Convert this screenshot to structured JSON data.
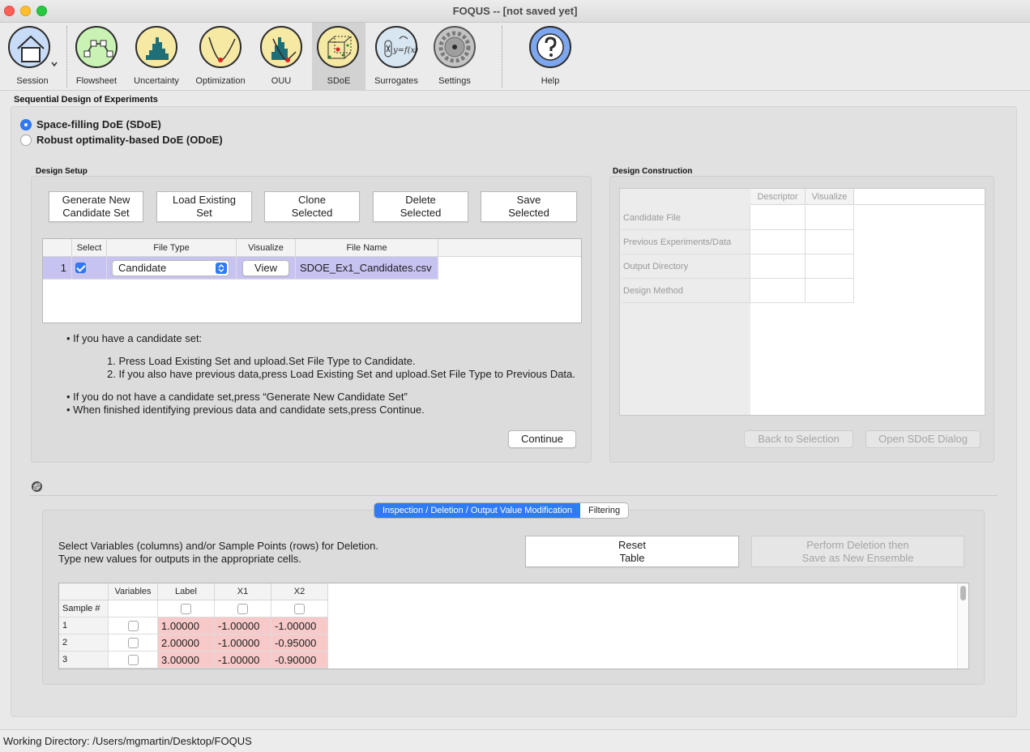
{
  "window": {
    "title": "FOQUS -- [not saved yet]"
  },
  "toolbar": {
    "items": [
      {
        "label": "Session",
        "icon": "house-icon"
      },
      {
        "label": "Flowsheet",
        "icon": "flowsheet-icon"
      },
      {
        "label": "Uncertainty",
        "icon": "histogram-icon"
      },
      {
        "label": "Optimization",
        "icon": "optimization-curve-icon"
      },
      {
        "label": "OUU",
        "icon": "ouu-icon"
      },
      {
        "label": "SDoE",
        "icon": "cube-icon"
      },
      {
        "label": "Surrogates",
        "icon": "function-icon"
      },
      {
        "label": "Settings",
        "icon": "gear-icon"
      },
      {
        "label": "Help",
        "icon": "help-icon"
      }
    ],
    "active": "SDoE",
    "surrogate_formula": "y=f(x)"
  },
  "page": {
    "title": "Sequential Design of Experiments",
    "radio_sdoe": "Space-filling DoE (SDoE)",
    "radio_odoe": "Robust optimality-based DoE (ODoE)"
  },
  "design_setup": {
    "title": "Design Setup",
    "buttons": {
      "generate": "Generate New\nCandidate Set",
      "load": "Load Existing\nSet",
      "clone": "Clone\nSelected",
      "delete": "Delete\nSelected",
      "save": "Save\nSelected"
    },
    "table": {
      "headers": [
        "",
        "Select",
        "File Type",
        "Visualize",
        "File Name"
      ],
      "rows": [
        {
          "index": "1",
          "selected": true,
          "file_type": "Candidate",
          "visualize": "View",
          "file_name": "SDOE_Ex1_Candidates.csv"
        }
      ]
    },
    "instructions": {
      "b1": "If you have a candidate set:",
      "s1": "1. Press Load Existing Set and upload.Set File Type to Candidate.",
      "s2": "2. If you also have previous data,press Load Existing Set and upload.Set File Type to Previous Data.",
      "b2": "If you do not have a candidate set,press “Generate New Candidate Set”",
      "b3": "When finished identifying previous data and candidate sets,press Continue."
    },
    "continue": "Continue"
  },
  "design_construction": {
    "title": "Design Construction",
    "headers": [
      "Descriptor",
      "Visualize"
    ],
    "rows": [
      "Candidate File",
      "Previous Experiments/Data",
      "Output Directory",
      "Design Method"
    ],
    "back": "Back to Selection",
    "open": "Open SDoE Dialog"
  },
  "inspection": {
    "tabs": [
      "Inspection / Deletion / Output Value Modification",
      "Filtering"
    ],
    "instructions_1": "Select Variables (columns) and/or Sample Points (rows) for Deletion.",
    "instructions_2": "Type new values for outputs in the appropriate cells.",
    "reset": "Reset\nTable",
    "perform": "Perform Deletion then\nSave as New Ensemble",
    "table": {
      "headers": [
        "Variables",
        "Label",
        "X1",
        "X2"
      ],
      "row_header": "Sample #",
      "rows": [
        {
          "n": "1",
          "label": "1.00000",
          "x1": "-1.00000",
          "x2": "-1.00000"
        },
        {
          "n": "2",
          "label": "2.00000",
          "x1": "-1.00000",
          "x2": "-0.95000"
        },
        {
          "n": "3",
          "label": "3.00000",
          "x1": "-1.00000",
          "x2": "-0.90000"
        }
      ]
    }
  },
  "status": {
    "working_directory": "Working Directory: /Users/mgmartin/Desktop/FOQUS"
  },
  "colors": {
    "accent": "#2f7bf6",
    "selected_row": "#c7c3f1",
    "pink_cell": "#f7c9c9"
  }
}
